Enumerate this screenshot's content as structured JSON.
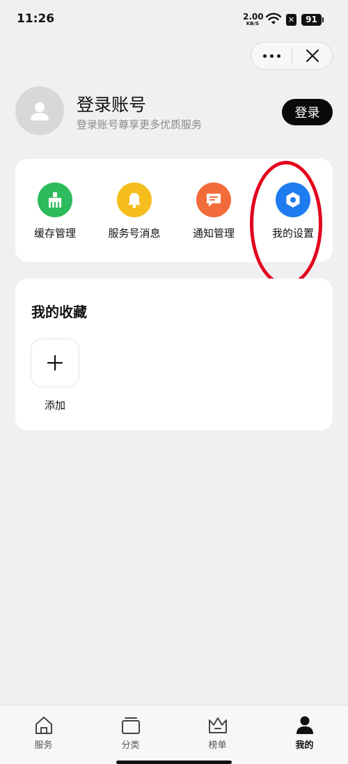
{
  "status_bar": {
    "time": "11:26",
    "net_speed_value": "2.00",
    "net_speed_unit": "KB/S",
    "sim_glyph": "✕",
    "battery_level": "91"
  },
  "profile": {
    "title": "登录账号",
    "subtitle": "登录账号尊享更多优质服务",
    "login_label": "登录"
  },
  "tools": [
    {
      "label": "缓存管理",
      "icon": "broom-icon",
      "color": "#2dbb5d"
    },
    {
      "label": "服务号消息",
      "icon": "bell-icon",
      "color": "#f5be1d"
    },
    {
      "label": "通知管理",
      "icon": "message-icon",
      "color": "#f26b3a"
    },
    {
      "label": "我的设置",
      "icon": "hexagon-settings-icon",
      "color": "#1e7cf0"
    }
  ],
  "favorites": {
    "title": "我的收藏",
    "add_label": "添加"
  },
  "bottom_nav": [
    {
      "label": "服务",
      "icon": "home-icon"
    },
    {
      "label": "分类",
      "icon": "category-icon"
    },
    {
      "label": "榜单",
      "icon": "crown-icon"
    },
    {
      "label": "我的",
      "icon": "person-icon",
      "active": true
    }
  ],
  "highlight_color": "#e3001b"
}
